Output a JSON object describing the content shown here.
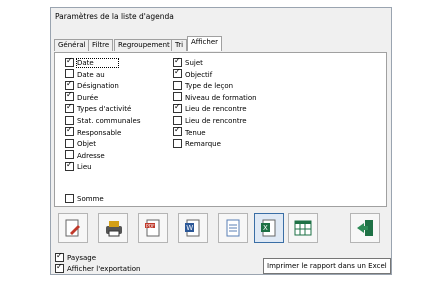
{
  "window": {
    "title": "Paramètres de la liste d'agenda"
  },
  "tabs": [
    "Général",
    "Filtre",
    "Regroupement",
    "Tri",
    "Afficher"
  ],
  "left_column": [
    {
      "label": "Date",
      "checked": true
    },
    {
      "label": "Date au",
      "checked": false
    },
    {
      "label": "Désignation",
      "checked": true
    },
    {
      "label": "Durée",
      "checked": true
    },
    {
      "label": "Types d'activité",
      "checked": true
    },
    {
      "label": "Stat. communales",
      "checked": false
    },
    {
      "label": "Responsable",
      "checked": true
    },
    {
      "label": "Objet",
      "checked": false
    },
    {
      "label": "Adresse",
      "checked": false
    },
    {
      "label": "Lieu",
      "checked": true
    }
  ],
  "right_column": [
    {
      "label": "Sujet",
      "checked": true
    },
    {
      "label": "Objectif",
      "checked": true
    },
    {
      "label": "Type de leçon",
      "checked": false
    },
    {
      "label": "Niveau de formation",
      "checked": false
    },
    {
      "label": "Lieu de rencontre",
      "checked": true
    },
    {
      "label": "Lieu de rencontre",
      "checked": false
    },
    {
      "label": "Tenue",
      "checked": true
    },
    {
      "label": "Remarque",
      "checked": false
    }
  ],
  "somme": {
    "label": "Somme",
    "checked": false
  },
  "toolbar_icons": [
    "report-icon",
    "print-icon",
    "pdf-icon",
    "word-icon",
    "document-icon",
    "excel-icon",
    "excel-table-icon",
    "exit-icon"
  ],
  "options": [
    {
      "label": "Paysage",
      "checked": true
    },
    {
      "label": "Afficher l'exportation",
      "checked": true
    }
  ],
  "tooltip": "Imprimer le rapport dans un Excel"
}
